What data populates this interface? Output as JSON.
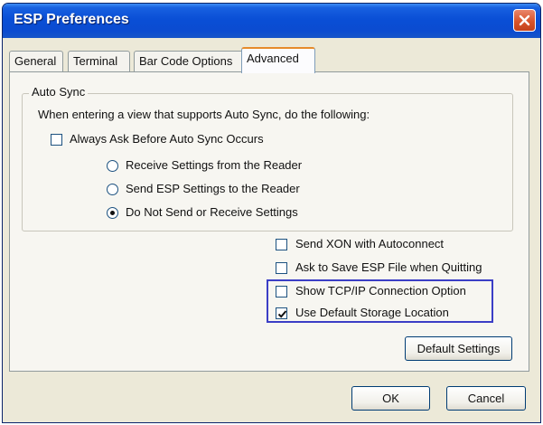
{
  "window": {
    "title": "ESP Preferences"
  },
  "tabs": [
    {
      "label": "General",
      "active": false
    },
    {
      "label": "Terminal",
      "active": false
    },
    {
      "label": "Bar Code Options",
      "active": false
    },
    {
      "label": "Advanced",
      "active": true
    }
  ],
  "auto_sync": {
    "group_label": "Auto Sync",
    "description": "When entering a view that supports Auto Sync, do the following:",
    "always_ask": {
      "label": "Always Ask Before Auto Sync Occurs",
      "checked": false
    },
    "options": [
      {
        "label": "Receive Settings from the Reader",
        "selected": false
      },
      {
        "label": "Send ESP Settings to the Reader",
        "selected": false
      },
      {
        "label": "Do Not Send or Receive Settings",
        "selected": true
      }
    ]
  },
  "advanced_options": [
    {
      "label": "Send XON with Autoconnect",
      "checked": false
    },
    {
      "label": "Ask to Save ESP File when Quitting",
      "checked": false
    },
    {
      "label": "Show TCP/IP Connection Option",
      "checked": false
    },
    {
      "label": "Use Default Storage Location",
      "checked": true
    }
  ],
  "buttons": {
    "default_settings": "Default Settings",
    "ok": "OK",
    "cancel": "Cancel"
  },
  "colors": {
    "titlebar": "#0b4bd0",
    "dialog_bg": "#ece9d8",
    "highlight_box": "#3b3ec6"
  }
}
